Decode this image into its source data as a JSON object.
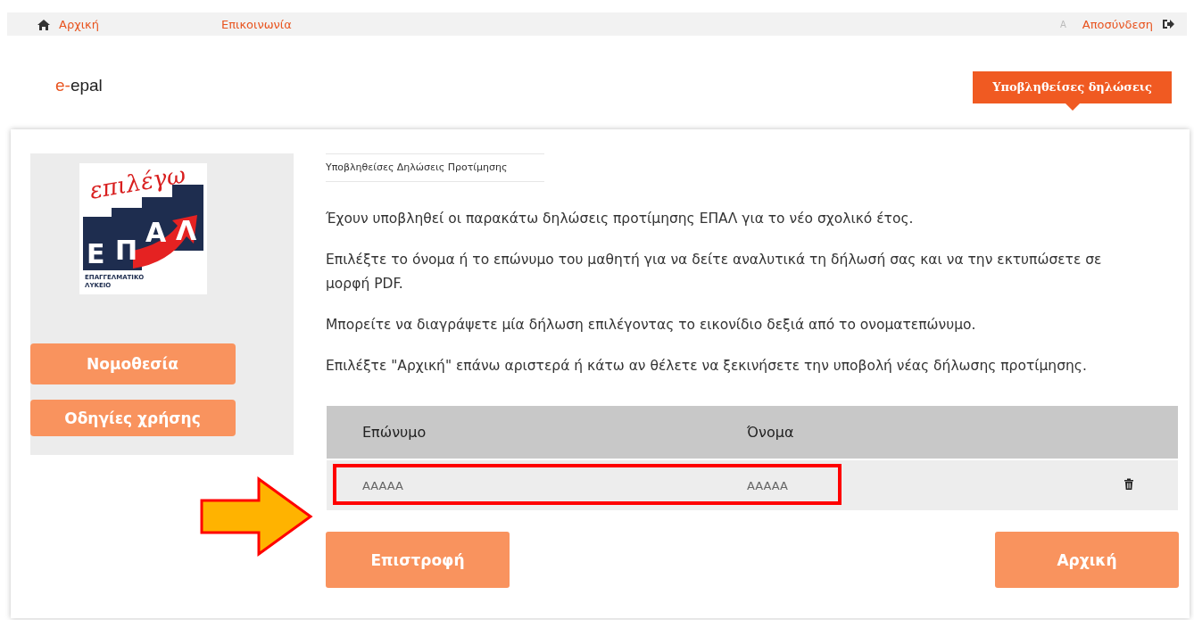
{
  "topbar": {
    "home_link": "Αρχική",
    "contact_link": "Επικοινωνία",
    "user_initial": "A",
    "logout_link": "Αποσύνδεση"
  },
  "header": {
    "brand_prefix": "e-",
    "brand": "epal",
    "tab": {
      "label": "Υποβληθείσες δηλώσεις",
      "selected": true
    }
  },
  "sidebar": {
    "logo": {
      "script": "επιλέγω",
      "letters": [
        "Ε",
        "Π",
        "Α",
        "Λ"
      ],
      "caption": [
        "ΕΠΑΓΓΕΛΜΑΤΙΚΟ",
        "ΛΥΚΕΙΟ"
      ]
    },
    "buttons": [
      "Νομοθεσία",
      "Οδηγίες χρήσης"
    ]
  },
  "breadcrumb": "Υποβληθείσες Δηλώσεις Προτίμησης",
  "paragraphs": [
    "Έχουν υποβληθεί οι παρακάτω δηλώσεις προτίμησης ΕΠΑΛ για το νέο σχολικό έτος.",
    "Επιλέξτε το όνομα ή το επώνυμο του μαθητή για να δείτε αναλυτικά τη δήλωσή σας και να την εκτυπώσετε σε μορφή PDF.",
    "Μπορείτε να διαγράψετε μία δήλωση επιλέγοντας το εικονίδιο δεξιά από το ονοματεπώνυμο.",
    "Επιλέξτε \"Αρχική\" επάνω αριστερά ή κάτω αν θέλετε να ξεκινήσετε την υποβολή νέας δήλωσης προτίμησης."
  ],
  "table": {
    "columns": [
      "Επώνυμο",
      "Όνομα"
    ],
    "rows": [
      {
        "cells": [
          "AAAAA",
          "AAAAA"
        ],
        "highlighted": true
      }
    ]
  },
  "buttons": [
    "Επιστροφή",
    "Αρχική"
  ]
}
